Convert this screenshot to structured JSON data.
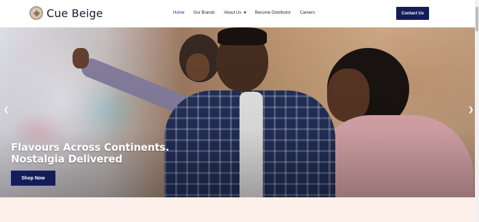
{
  "brand": {
    "name": "Cue Beige",
    "logo_icon": "cue-beige-logo-icon"
  },
  "nav": {
    "items": [
      {
        "label": "Home",
        "active": true
      },
      {
        "label": "Our Brands",
        "active": false
      },
      {
        "label": "About Us",
        "active": false,
        "has_dropdown": true
      },
      {
        "label": "Become Distributor",
        "active": false
      },
      {
        "label": "Careers",
        "active": false
      }
    ],
    "contact_label": "Contact Us"
  },
  "hero": {
    "title_line1": "Flavours Across Continents.",
    "title_line2": "Nostalgia Delivered",
    "cta_label": "Shop Now",
    "prev_icon": "chevron-left-icon",
    "next_icon": "chevron-right-icon"
  },
  "colors": {
    "primary": "#141d5a",
    "nav_active": "#1e2a78",
    "section_bg": "#fdf0ea"
  }
}
